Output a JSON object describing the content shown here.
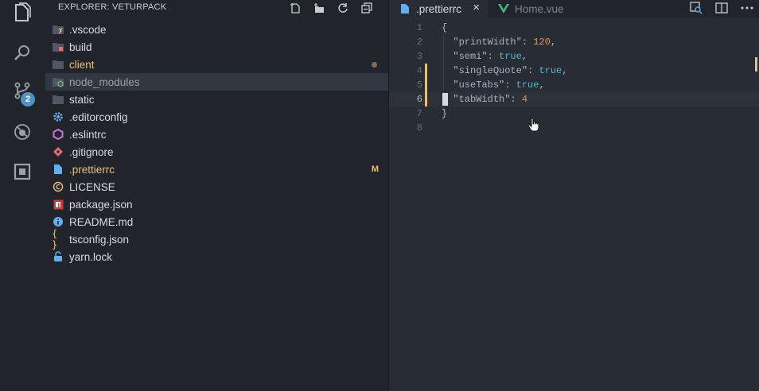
{
  "sidebar": {
    "title": "EXPLORER: VETURPACK",
    "actions": [
      "new-file-icon",
      "new-folder-icon",
      "refresh-icon",
      "collapse-all-icon"
    ],
    "items": [
      {
        "label": "› .vscode",
        "text": ".vscode",
        "icon": "folder-vscode-icon",
        "color": "#d7dae0",
        "status": ""
      },
      {
        "label": "build",
        "text": "build",
        "icon": "folder-build-icon",
        "color": "#d7dae0",
        "status": ""
      },
      {
        "label": "client",
        "text": "client",
        "icon": "folder-icon",
        "color": "#e5c07b",
        "status": "dot"
      },
      {
        "label": "node_modules",
        "text": "node_modules",
        "icon": "folder-node-icon",
        "color": "#9aa1ad",
        "status": ""
      },
      {
        "label": "static",
        "text": "static",
        "icon": "folder-icon",
        "color": "#d7dae0",
        "status": ""
      },
      {
        "label": ".editorconfig",
        "text": ".editorconfig",
        "icon": "gear-icon",
        "color": "#d7dae0",
        "status": ""
      },
      {
        "label": ".eslintrc",
        "text": ".eslintrc",
        "icon": "eslint-icon",
        "color": "#d7dae0",
        "status": ""
      },
      {
        "label": ".gitignore",
        "text": ".gitignore",
        "icon": "git-icon",
        "color": "#d7dae0",
        "status": ""
      },
      {
        "label": ".prettierrc",
        "text": ".prettierrc",
        "icon": "file-icon",
        "color": "#e5c07b",
        "status": "M"
      },
      {
        "label": "LICENSE",
        "text": "LICENSE",
        "icon": "copyright-icon",
        "color": "#d7dae0",
        "status": ""
      },
      {
        "label": "package.json",
        "text": "package.json",
        "icon": "npm-icon",
        "color": "#d7dae0",
        "status": ""
      },
      {
        "label": "README.md",
        "text": "README.md",
        "icon": "info-icon",
        "color": "#d7dae0",
        "status": ""
      },
      {
        "label": "tsconfig.json",
        "text": "tsconfig.json",
        "icon": "braces-icon",
        "color": "#d7dae0",
        "status": ""
      },
      {
        "label": "yarn.lock",
        "text": "yarn.lock",
        "icon": "yarn-icon",
        "color": "#d7dae0",
        "status": ""
      }
    ]
  },
  "activity": {
    "scm_badge": "2"
  },
  "tabs": [
    {
      "label": ".prettierrc",
      "active": true
    },
    {
      "label": "Home.vue",
      "active": false
    }
  ],
  "tab_close": "×",
  "editor": {
    "lines": [
      {
        "n": "1",
        "html": "{"
      },
      {
        "n": "2",
        "html": "  \"printWidth\": 120,"
      },
      {
        "n": "3",
        "html": "  \"semi\": true,"
      },
      {
        "n": "4",
        "html": "  \"singleQuote\": true,"
      },
      {
        "n": "5",
        "html": "  \"useTabs\": true,"
      },
      {
        "n": "6",
        "html": "  \"tabWidth\": 4"
      },
      {
        "n": "7",
        "html": "}"
      },
      {
        "n": "8",
        "html": ""
      }
    ]
  },
  "colors": {
    "accent_modified": "#e5c07b",
    "badge": "#4d95c0",
    "vue_green": "#41b883"
  }
}
